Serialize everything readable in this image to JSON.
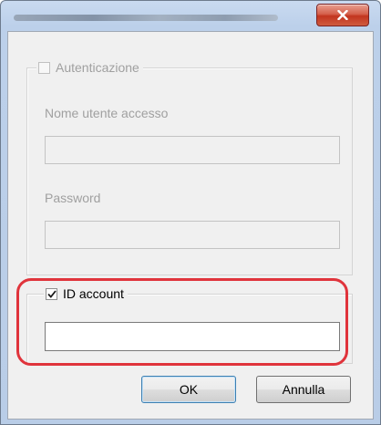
{
  "window": {
    "title": "",
    "close_icon": "close-icon"
  },
  "auth_group": {
    "checkbox_label": "Autenticazione",
    "checked": false,
    "enabled": false,
    "username_label": "Nome utente accesso",
    "username_value": "",
    "password_label": "Password",
    "password_value": ""
  },
  "account_group": {
    "checkbox_label": "ID account",
    "checked": true,
    "account_value": ""
  },
  "buttons": {
    "ok": "OK",
    "cancel": "Annulla"
  },
  "colors": {
    "highlight": "#e0343c",
    "close_button": "#c2351f"
  }
}
